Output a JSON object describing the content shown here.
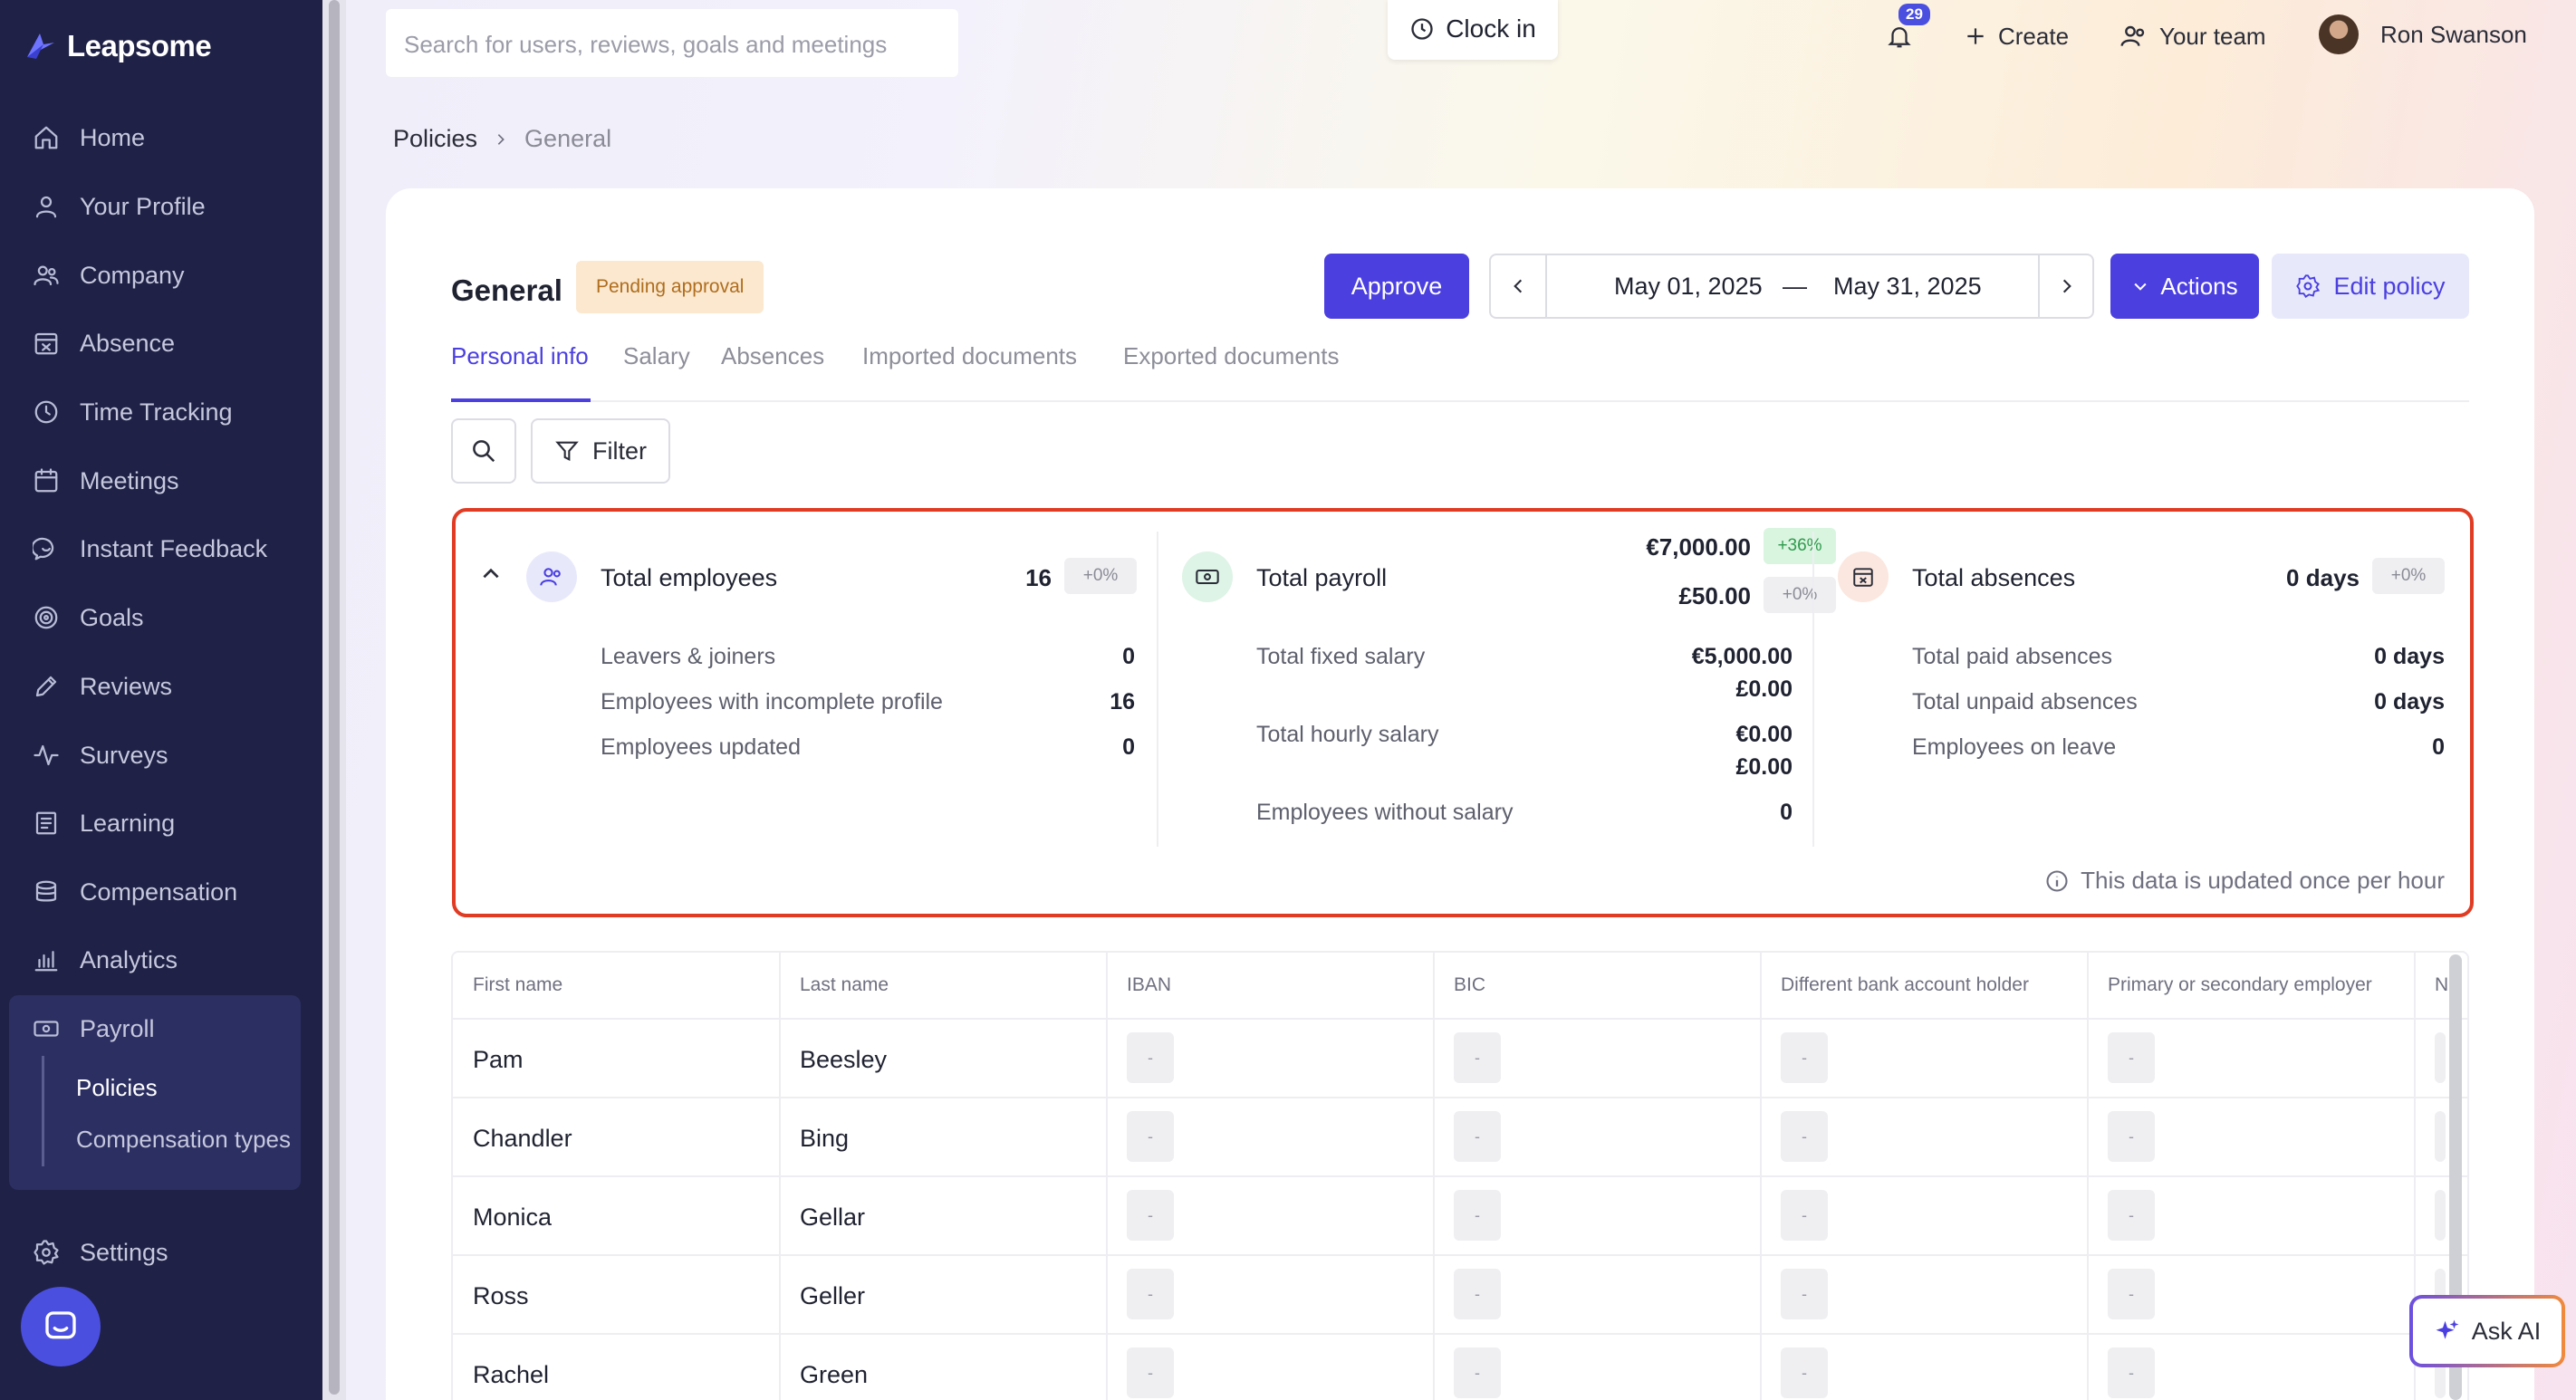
{
  "app": {
    "name": "Leapsome"
  },
  "sidebar": {
    "items": [
      {
        "label": "Home",
        "icon": "home-icon"
      },
      {
        "label": "Your Profile",
        "icon": "user-icon"
      },
      {
        "label": "Company",
        "icon": "users-icon"
      },
      {
        "label": "Absence",
        "icon": "calendar-x-icon"
      },
      {
        "label": "Time Tracking",
        "icon": "clock-icon"
      },
      {
        "label": "Meetings",
        "icon": "calendar-icon"
      },
      {
        "label": "Instant Feedback",
        "icon": "chat-icon"
      },
      {
        "label": "Goals",
        "icon": "target-icon"
      },
      {
        "label": "Reviews",
        "icon": "pencil-icon"
      },
      {
        "label": "Surveys",
        "icon": "pulse-icon"
      },
      {
        "label": "Learning",
        "icon": "book-icon"
      },
      {
        "label": "Compensation",
        "icon": "coins-icon"
      },
      {
        "label": "Analytics",
        "icon": "bar-chart-icon"
      },
      {
        "label": "Payroll",
        "icon": "banknote-icon"
      }
    ],
    "payroll_sub": [
      {
        "label": "Policies",
        "active": true
      },
      {
        "label": "Compensation types",
        "active": false
      }
    ],
    "settings_label": "Settings"
  },
  "header": {
    "search_placeholder": "Search for users, reviews, goals and meetings",
    "clock_in": "Clock in",
    "notifications_count": "29",
    "create": "Create",
    "your_team": "Your team",
    "user_name": "Ron Swanson"
  },
  "breadcrumb": {
    "parent": "Policies",
    "current": "General"
  },
  "policy": {
    "title": "General",
    "status": "Pending approval",
    "approve": "Approve",
    "date_start": "May 01, 2025",
    "date_sep": "—",
    "date_end": "May 31, 2025",
    "actions": "Actions",
    "edit_policy": "Edit policy"
  },
  "tabs": [
    "Personal info",
    "Salary",
    "Absences",
    "Imported documents",
    "Exported documents"
  ],
  "filter_label": "Filter",
  "summary": {
    "employees": {
      "title": "Total employees",
      "value": "16",
      "change": "+0%",
      "rows": [
        {
          "label": "Leavers & joiners",
          "value": "0"
        },
        {
          "label": "Employees with incomplete profile",
          "value": "16"
        },
        {
          "label": "Employees updated",
          "value": "0"
        }
      ]
    },
    "payroll": {
      "title": "Total payroll",
      "value_eur": "€7,000.00",
      "change_eur": "+36%",
      "value_gbp": "£50.00",
      "change_gbp": "+0%",
      "fixed_label": "Total fixed salary",
      "fixed_eur": "€5,000.00",
      "fixed_gbp": "£0.00",
      "hourly_label": "Total hourly salary",
      "hourly_eur": "€0.00",
      "hourly_gbp": "£0.00",
      "without_label": "Employees without salary",
      "without_value": "0"
    },
    "absences": {
      "title": "Total absences",
      "value": "0 days",
      "change": "+0%",
      "rows": [
        {
          "label": "Total paid absences",
          "value": "0 days"
        },
        {
          "label": "Total unpaid absences",
          "value": "0 days"
        },
        {
          "label": "Employees on leave",
          "value": "0"
        }
      ]
    },
    "note": "This data is updated once per hour"
  },
  "table": {
    "columns": [
      "First name",
      "Last name",
      "IBAN",
      "BIC",
      "Different bank account holder",
      "Primary or secondary employer",
      "N"
    ],
    "rows": [
      {
        "first": "Pam",
        "last": "Beesley"
      },
      {
        "first": "Chandler",
        "last": "Bing"
      },
      {
        "first": "Monica",
        "last": "Gellar"
      },
      {
        "first": "Ross",
        "last": "Geller"
      },
      {
        "first": "Rachel",
        "last": "Green"
      }
    ],
    "empty_value": "-"
  },
  "ask_ai": "Ask AI",
  "colors": {
    "accent": "#4b3fe0",
    "sidebar": "#1f2146",
    "highlight": "#e03b23"
  }
}
